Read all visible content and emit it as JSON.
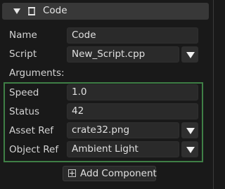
{
  "component": {
    "title": "Code",
    "collapse_icon": "caret-down-icon",
    "type_icon": "scroll-icon"
  },
  "fields": {
    "name": {
      "label": "Name",
      "value": "Code"
    },
    "script": {
      "label": "Script",
      "value": "New_Script.cpp"
    }
  },
  "arguments": {
    "heading": "Arguments:",
    "speed": {
      "label": "Speed",
      "value": "1.0"
    },
    "status": {
      "label": "Status",
      "value": "42"
    },
    "asset_ref": {
      "label": "Asset Ref",
      "value": "crate32.png"
    },
    "object_ref": {
      "label": "Object Ref",
      "value": "Ambient Light"
    }
  },
  "add_component": {
    "label": "Add Component",
    "icon": "plus-box-icon"
  },
  "colors": {
    "background": "#191919",
    "header": "#383838",
    "field": "#2a2a2a",
    "highlight_border": "#3f7f46"
  }
}
